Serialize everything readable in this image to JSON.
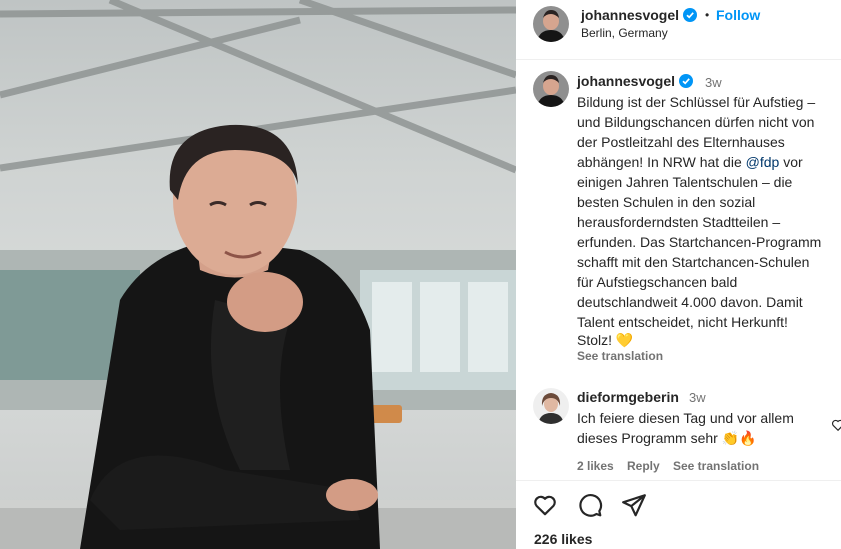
{
  "post": {
    "photo_alt": "Portrait photo",
    "author": {
      "username": "johannesvogel",
      "follow_label": "Follow",
      "separator": "•",
      "location": "Berlin, Germany"
    },
    "caption": {
      "username": "johannesvogel",
      "time": "3w",
      "lines": [
        "Bildung ist der Schlüssel für Aufstieg –",
        "und Bildungschancen dürfen nicht von",
        "der Postleitzahl des Elternhauses",
        "abhängen! In NRW hat die",
        "einigen Jahren Talentschulen – die",
        "besten Schulen in den sozial",
        "herausforderndsten Stadtteilen –",
        "erfunden. Das Startchancen-Programm",
        "schafft mit den Startchancen-Schulen",
        "für Aufstiegschancen bald",
        "deutschlandweit 4.000 davon. Damit",
        "Talent entscheidet, nicht Herkunft!",
        "Stolz!"
      ],
      "mention": "@fdp",
      "mention_after": " vor",
      "emoji_end": "💛",
      "see_translation": "See translation"
    },
    "comment": {
      "username": "dieformgeberin",
      "time": "3w",
      "lines": [
        "Ich feiere diesen Tag und vor allem",
        "dieses Programm sehr"
      ],
      "emoji": "👏🔥",
      "likes": "2 likes",
      "reply": "Reply",
      "see_translation": "See translation"
    },
    "likes": "226 likes"
  },
  "icons": [
    "verified-badge-icon",
    "heart-icon",
    "comment-icon",
    "share-icon"
  ],
  "colors": {
    "link": "#0095f6",
    "verified": "#0095f6",
    "muted": "#737373"
  }
}
